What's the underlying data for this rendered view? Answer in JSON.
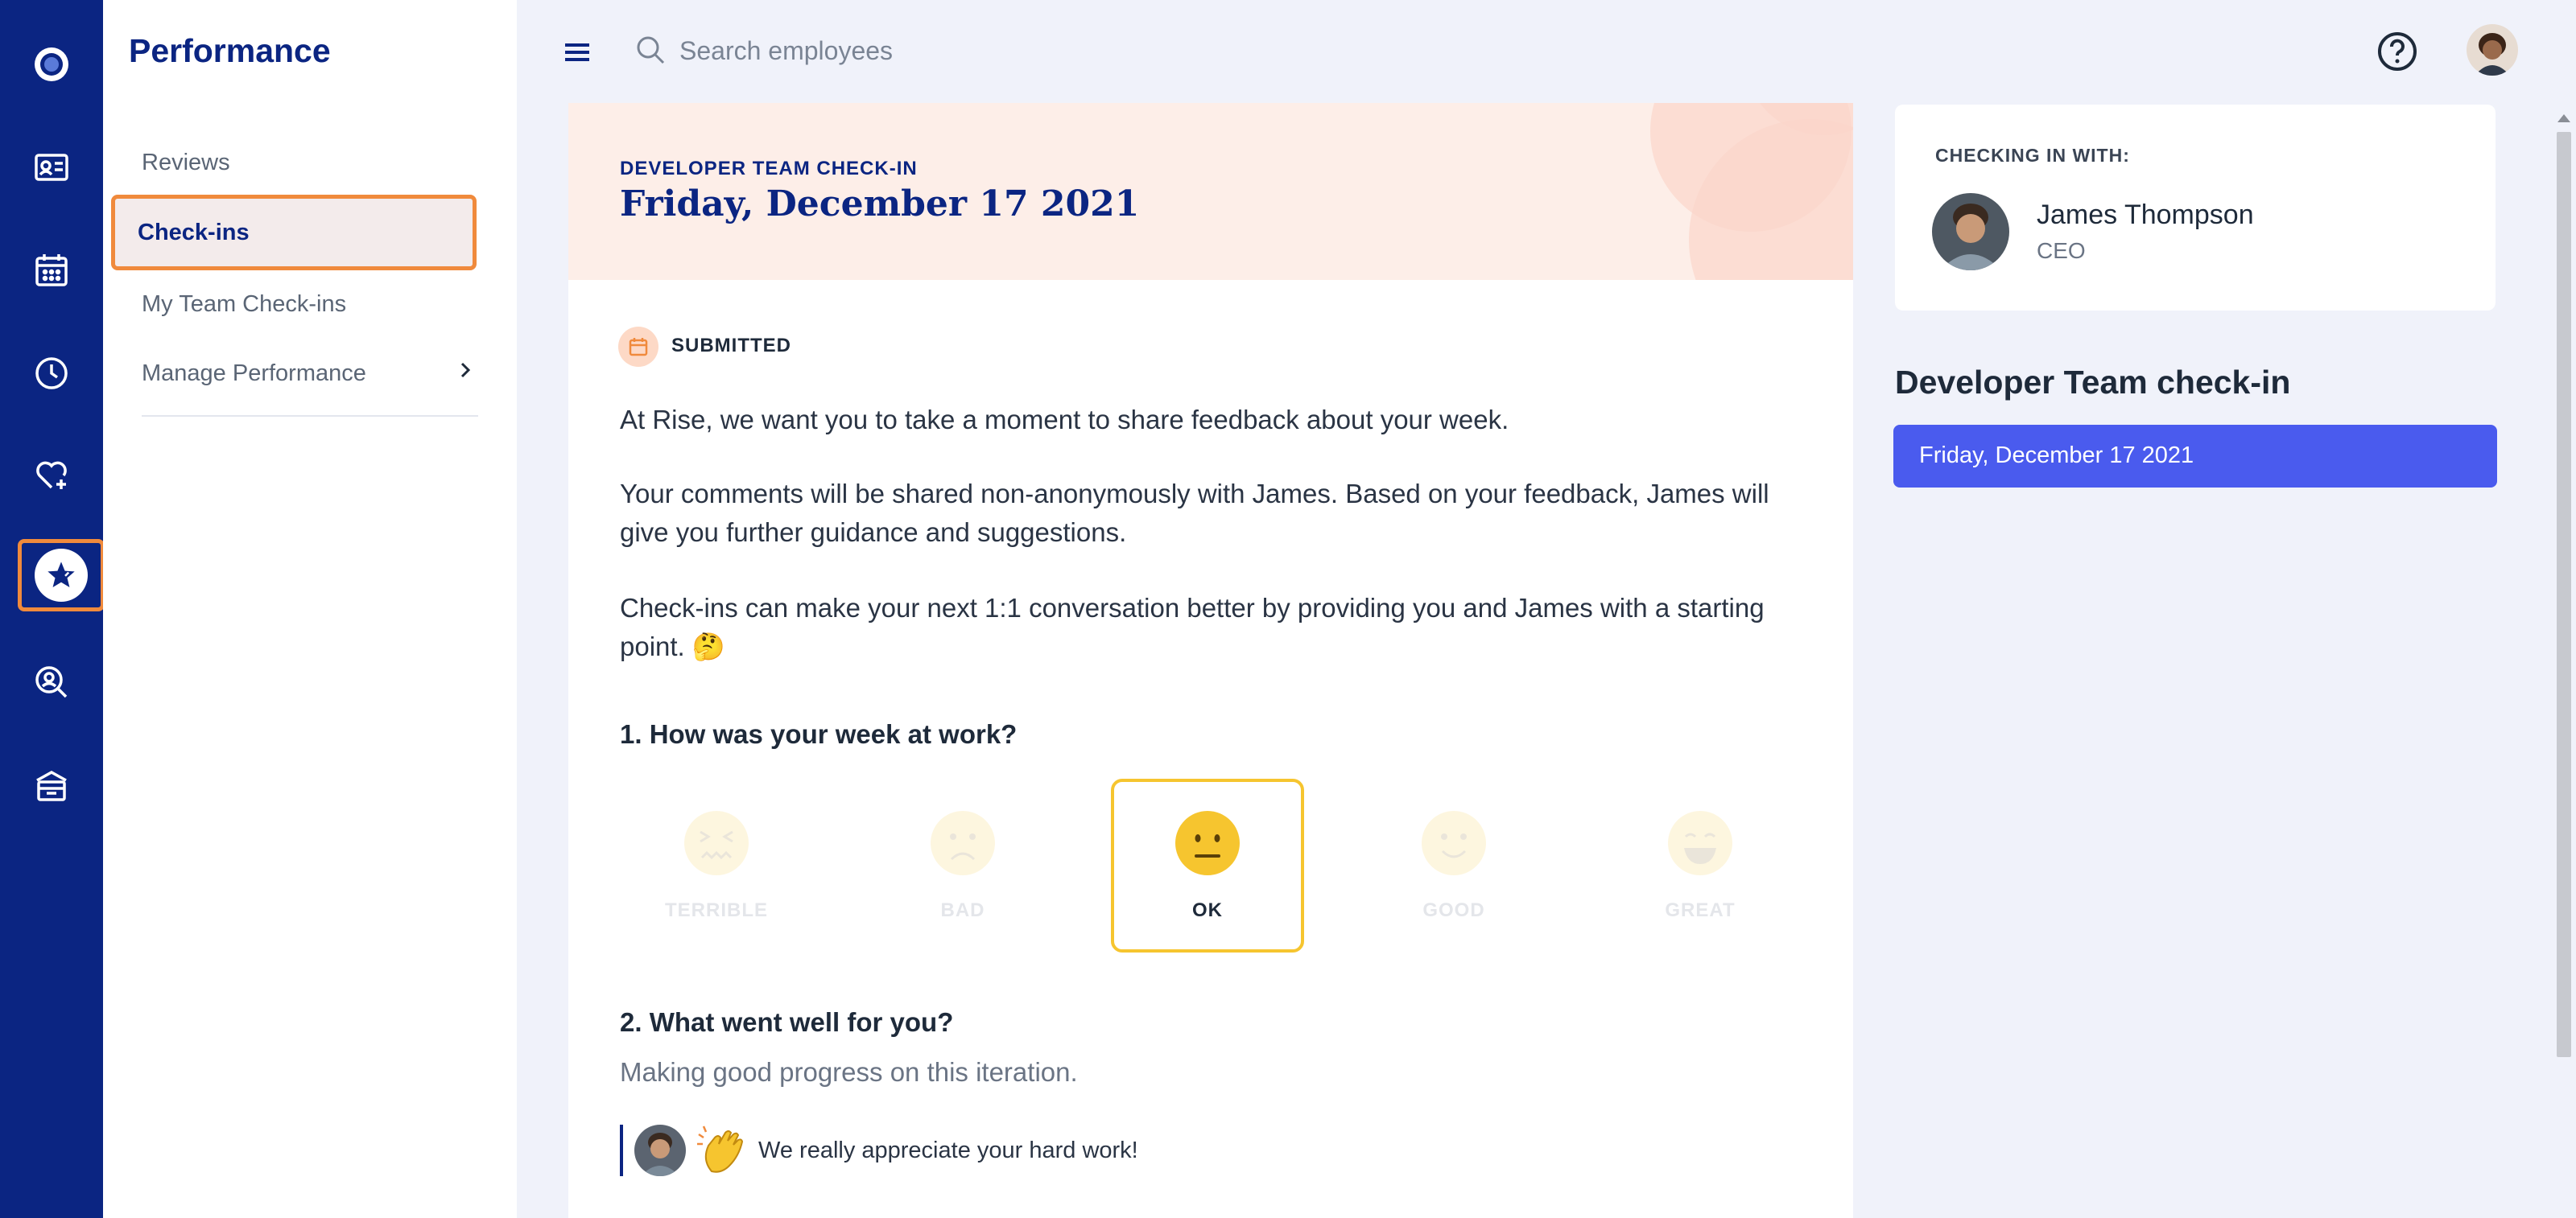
{
  "sidebar_rail": {
    "items": [
      {
        "icon": "logo-icon"
      },
      {
        "icon": "id-card-icon"
      },
      {
        "icon": "calendar-icon"
      },
      {
        "icon": "clock-icon"
      },
      {
        "icon": "heart-plus-icon"
      },
      {
        "icon": "star-icon",
        "active": true
      },
      {
        "icon": "search-person-icon"
      },
      {
        "icon": "box-icon"
      }
    ],
    "active_color": "#f08a3c"
  },
  "nav": {
    "title": "Performance",
    "items": [
      {
        "label": "Reviews"
      },
      {
        "label": "Check-ins",
        "active": true
      },
      {
        "label": "My Team Check-ins"
      },
      {
        "label": "Manage Performance"
      }
    ]
  },
  "topbar": {
    "search_placeholder": "Search employees",
    "help_icon": "help-icon",
    "menu_icon": "menu-icon"
  },
  "checkin": {
    "eyebrow": "DEVELOPER TEAM CHECK-IN",
    "date": "Friday, December 17 2021",
    "status": "SUBMITTED",
    "intro": "At Rise, we want you to take a moment to share feedback about your week.",
    "intro2": "Your comments will be shared non-anonymously with James. Based on your feedback, James will give you further guidance and suggestions.",
    "intro3": "Check-ins can make your next 1:1 conversation better by providing you and James with a starting point. 🤔",
    "q1": "1. How was your week at work?",
    "moods": [
      {
        "label": "TERRIBLE"
      },
      {
        "label": "BAD"
      },
      {
        "label": "OK",
        "selected": true
      },
      {
        "label": "GOOD"
      },
      {
        "label": "GREAT"
      }
    ],
    "q2": "2. What went well for you?",
    "a2": "Making good progress on this iteration.",
    "reaction": {
      "emoji": "clapping-hands-icon",
      "text": "We really appreciate your hard work!"
    }
  },
  "side": {
    "eyebrow": "CHECKING IN WITH:",
    "name": "James Thompson",
    "role": "CEO",
    "title": "Developer Team check-in",
    "date_button": "Friday, December 17 2021"
  },
  "colors": {
    "rail": "#0b2582",
    "accent": "#4a5bee",
    "selected_mood": "#f6c52f",
    "header_bg": "#fdeee8"
  }
}
